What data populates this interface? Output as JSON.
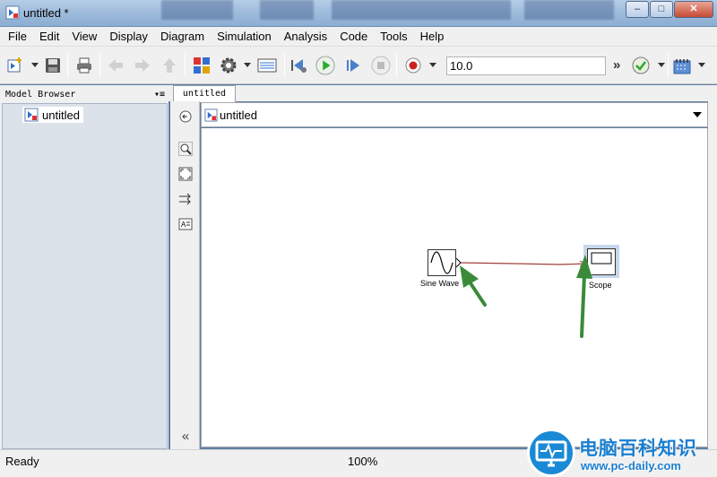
{
  "window": {
    "title": "untitled *"
  },
  "menu": [
    "File",
    "Edit",
    "View",
    "Display",
    "Diagram",
    "Simulation",
    "Analysis",
    "Code",
    "Tools",
    "Help"
  ],
  "toolbar": {
    "stop_time": "10.0",
    "more": "»"
  },
  "browser": {
    "title": "Model Browser",
    "tree_item": "untitled"
  },
  "editor": {
    "tab": "untitled",
    "address": "untitled"
  },
  "blocks": {
    "sine": "Sine Wave",
    "scope": "Scope"
  },
  "status": {
    "left": "Ready",
    "zoom": "100%"
  },
  "watermark": {
    "text": "电脑百科知识",
    "url": "www.pc-daily.com"
  },
  "colors": {
    "signal_line": "#a0413b",
    "annotation_arrow": "#3a8a3a",
    "run_button": "#2fa82f"
  }
}
